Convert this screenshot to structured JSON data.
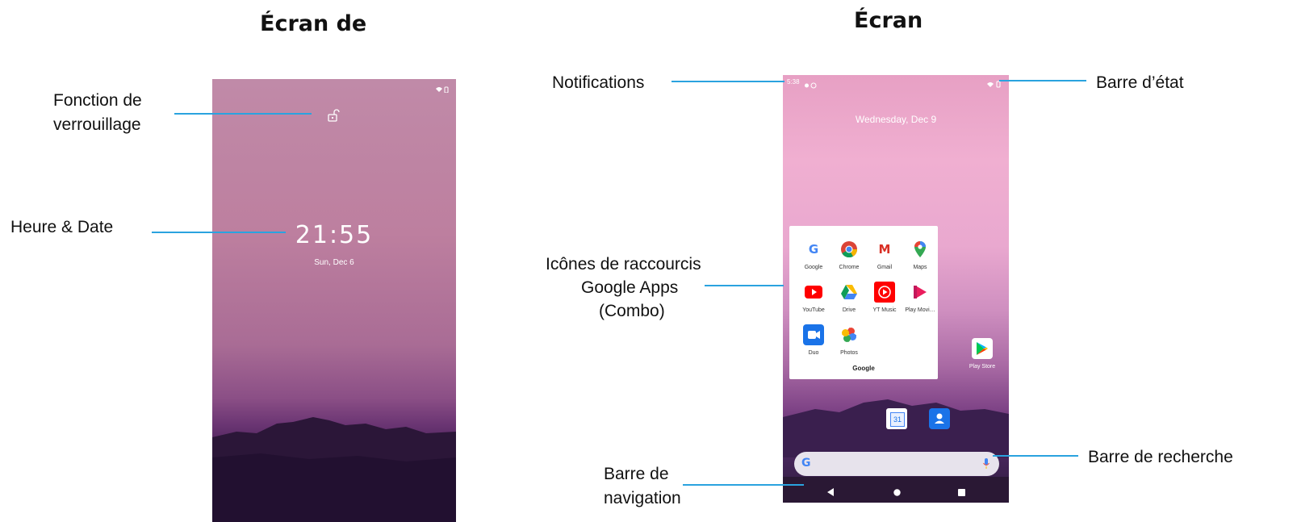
{
  "titles": {
    "left": "Écran de",
    "right": "Écran"
  },
  "callouts": {
    "lock_function": [
      "Fonction de",
      "verrouillage"
    ],
    "time_date": "Heure & Date",
    "notifications": "Notifications",
    "shortcuts": [
      "Icônes de raccourcis",
      "Google Apps",
      "(Combo)"
    ],
    "navigation": [
      "Barre de",
      "navigation"
    ],
    "status_bar": "Barre d’état",
    "search_bar": "Barre de recherche"
  },
  "lock_screen": {
    "time": "21:55",
    "date": "Sun, Dec 6"
  },
  "home_screen": {
    "status_time": "5:38",
    "date": "Wednesday, Dec 9",
    "folder_name": "Google",
    "apps": [
      {
        "name": "Google",
        "icon": "google-icon"
      },
      {
        "name": "Chrome",
        "icon": "chrome-icon"
      },
      {
        "name": "Gmail",
        "icon": "gmail-icon"
      },
      {
        "name": "Maps",
        "icon": "maps-icon"
      },
      {
        "name": "YouTube",
        "icon": "youtube-icon"
      },
      {
        "name": "Drive",
        "icon": "drive-icon"
      },
      {
        "name": "YT Music",
        "icon": "yt-music-icon"
      },
      {
        "name": "Play Movi…",
        "icon": "play-movies-icon"
      },
      {
        "name": "Duo",
        "icon": "duo-icon"
      },
      {
        "name": "Photos",
        "icon": "photos-icon"
      }
    ],
    "play_store": "Play Store",
    "calendar_day": "31"
  },
  "colors": {
    "callout_line": "#2aa3df"
  }
}
